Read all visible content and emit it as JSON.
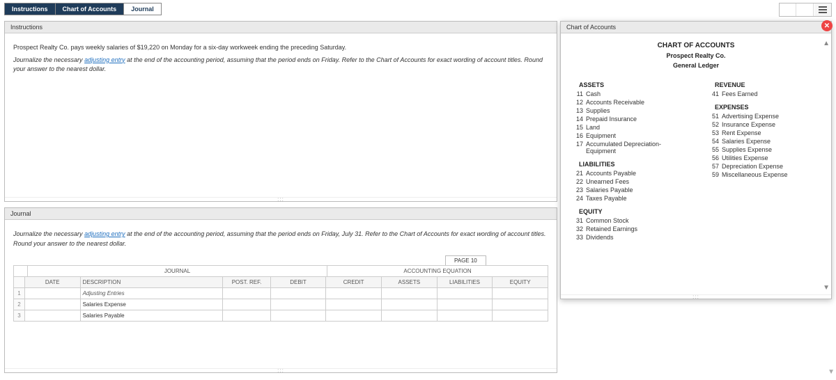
{
  "tabs": {
    "instructions": "Instructions",
    "chart": "Chart of Accounts",
    "journal": "Journal"
  },
  "instructions": {
    "title": "Instructions",
    "line1": "Prospect Realty Co. pays weekly salaries of $19,220 on Monday for a six-day workweek ending the preceding Saturday.",
    "line2_pre": "Journalize the necessary ",
    "line2_link": "adjusting entry",
    "line2_post": " at the end of the accounting period, assuming that the period ends on Friday. Refer to the Chart of Accounts for exact wording of account titles. Round your answer to the nearest dollar."
  },
  "journal_panel": {
    "title": "Journal",
    "instr_pre": "Journalize the necessary ",
    "instr_link": "adjusting entry",
    "instr_post": " at the end of the accounting period, assuming that the period ends on Friday, July 31. Refer to the Chart of Accounts for exact wording of account titles. Round your answer to the nearest dollar.",
    "page_label": "PAGE 10",
    "section_journal": "JOURNAL",
    "section_ae": "ACCOUNTING EQUATION",
    "headers": {
      "date": "DATE",
      "desc": "DESCRIPTION",
      "pr": "POST. REF.",
      "debit": "DEBIT",
      "credit": "CREDIT",
      "assets": "ASSETS",
      "liab": "LIABILITIES",
      "equity": "EQUITY"
    },
    "rows": [
      {
        "n": "1",
        "desc": "Adjusting Entries",
        "italic": true
      },
      {
        "n": "2",
        "desc": "Salaries Expense",
        "italic": false
      },
      {
        "n": "3",
        "desc": "Salaries Payable",
        "italic": false
      }
    ]
  },
  "coa": {
    "title": "Chart of Accounts",
    "h1": "CHART OF ACCOUNTS",
    "h2": "Prospect Realty Co.",
    "h3": "General Ledger",
    "sections": {
      "assets_title": "ASSETS",
      "assets": [
        {
          "n": "11",
          "name": "Cash"
        },
        {
          "n": "12",
          "name": "Accounts Receivable"
        },
        {
          "n": "13",
          "name": "Supplies"
        },
        {
          "n": "14",
          "name": "Prepaid Insurance"
        },
        {
          "n": "15",
          "name": "Land"
        },
        {
          "n": "16",
          "name": "Equipment"
        },
        {
          "n": "17",
          "name": "Accumulated Depreciation-Equipment"
        }
      ],
      "liab_title": "LIABILITIES",
      "liab": [
        {
          "n": "21",
          "name": "Accounts Payable"
        },
        {
          "n": "22",
          "name": "Unearned Fees"
        },
        {
          "n": "23",
          "name": "Salaries Payable"
        },
        {
          "n": "24",
          "name": "Taxes Payable"
        }
      ],
      "equity_title": "EQUITY",
      "equity": [
        {
          "n": "31",
          "name": "Common Stock"
        },
        {
          "n": "32",
          "name": "Retained Earnings"
        },
        {
          "n": "33",
          "name": "Dividends"
        }
      ],
      "rev_title": "REVENUE",
      "rev": [
        {
          "n": "41",
          "name": "Fees Earned"
        }
      ],
      "exp_title": "EXPENSES",
      "exp": [
        {
          "n": "51",
          "name": "Advertising Expense"
        },
        {
          "n": "52",
          "name": "Insurance Expense"
        },
        {
          "n": "53",
          "name": "Rent Expense"
        },
        {
          "n": "54",
          "name": "Salaries Expense"
        },
        {
          "n": "55",
          "name": "Supplies Expense"
        },
        {
          "n": "56",
          "name": "Utilities Expense"
        },
        {
          "n": "57",
          "name": "Depreciation Expense"
        },
        {
          "n": "59",
          "name": "Miscellaneous Expense"
        }
      ]
    }
  }
}
